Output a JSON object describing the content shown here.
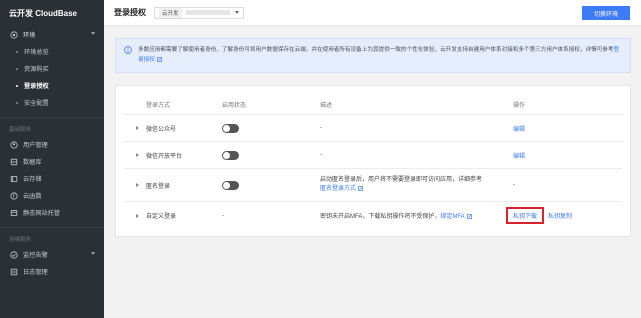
{
  "sidebar": {
    "brand": "云开发 CloudBase",
    "env_group": "环境",
    "env_items": [
      "环境总览",
      "资源购买",
      "登录授权",
      "安全配置"
    ],
    "section_basic": "基础服务",
    "basic_items": [
      {
        "label": "用户管理",
        "icon": "user-icon"
      },
      {
        "label": "数据库",
        "icon": "database-icon"
      },
      {
        "label": "云存储",
        "icon": "cloud-storage-icon"
      },
      {
        "label": "云函数",
        "icon": "function-icon"
      },
      {
        "label": "静态网站托管",
        "icon": "hosting-icon"
      }
    ],
    "section_ops": "运维服务",
    "ops_items": [
      {
        "label": "监控告警",
        "icon": "monitor-icon"
      },
      {
        "label": "日志管理",
        "icon": "log-icon"
      }
    ]
  },
  "header": {
    "title": "登录授权",
    "env_tag": "云开发",
    "switch_env_button": "切换环境"
  },
  "banner": {
    "text": "多数应用都需要了解使用者身份，了解身份可将用户数据保存在云端，并在使用者所有设备上为其提供一致的个性化体验，云开发支持自建用户体系对接和多个第三方用户体系授权，详情可参考",
    "link": "登录授权"
  },
  "table": {
    "headers": [
      "登录方式",
      "启用状态",
      "描述",
      "操作"
    ],
    "rows": [
      {
        "method": "微信公众号",
        "status": "toggle",
        "desc": "-",
        "action": "编辑"
      },
      {
        "method": "微信开放平台",
        "status": "toggle",
        "desc": "-",
        "action": "编辑"
      },
      {
        "method": "匿名登录",
        "status": "toggle",
        "desc_line1": "启动匿名登录后，用户将不需要登录即可访问应用，详细参考",
        "desc_link": "匿名登录方式",
        "action": "-"
      },
      {
        "method": "自定义登录",
        "status": "-",
        "desc": "密钥未开启MFA，下载私钥操作将不受保护，",
        "desc_link": "绑定MFA",
        "action1": "私钥下载",
        "action2": "私钥复制"
      }
    ]
  },
  "colors": {
    "accent": "#3e7bf7",
    "highlight": "#d6232d",
    "sidebar": "#2b2f36"
  }
}
